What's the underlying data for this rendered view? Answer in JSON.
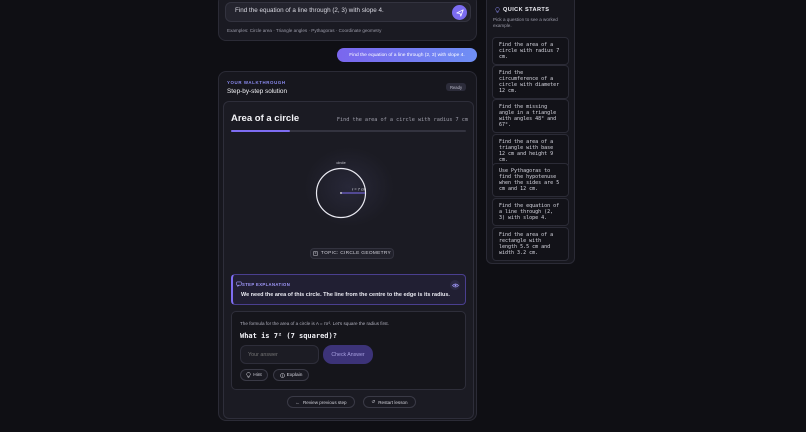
{
  "ask": {
    "input_value": "Find the equation of a line through (2, 3) with slope 4.",
    "examples": "Examples: Circle area · Triangle angles · Pythagoras · Coordinate geometry"
  },
  "user_message": "Find the equation of a line through (2, 3) with slope 4.",
  "walkthrough": {
    "kicker": "YOUR WALKTHROUGH",
    "subtitle": "Step-by-step solution",
    "status": "Ready",
    "lesson_title": "Area of a circle",
    "lesson_question": "Find the area of a circle with radius 7 cm",
    "progress_fraction": 0.25,
    "figure": {
      "title": "circle",
      "radius_label": "r = 7 cm"
    },
    "topic": "TOPIC: CIRCLE GEOMETRY",
    "explanation": {
      "kicker": "STEP EXPLANATION",
      "text": "We need the area of this circle. The line from the centre to the edge is its radius."
    },
    "question_card": {
      "formula_text": "The formula for the area of a circle is A = πr². Let's square the radius first.",
      "question": "What is 7² (7 squared)?",
      "answer_placeholder": "Your answer",
      "check_label": "Check Answer",
      "hint_label": "Hint",
      "explain_label": "Explain"
    },
    "review_label": "Review previous step",
    "restart_label": "Restart lesson"
  },
  "quick_starts": {
    "title": "QUICK STARTS",
    "description": "Pick a question to see a worked example.",
    "items": [
      "Find the area of a circle with radius 7 cm.",
      "Find the circumference of a circle with diameter 12 cm.",
      "Find the missing angle in a triangle with angles 48° and 67°.",
      "Find the area of a triangle with base 12 cm and height 9 cm.",
      "Use Pythagoras to find the hypotenuse when the sides are 5 cm and 12 cm.",
      "Find the equation of a line through (2, 3) with slope 4.",
      "Find the area of a rectangle with length 5.5 cm and width 3.2 cm."
    ]
  },
  "colors": {
    "accent": "#7e6df2",
    "background": "#0f0f14"
  }
}
